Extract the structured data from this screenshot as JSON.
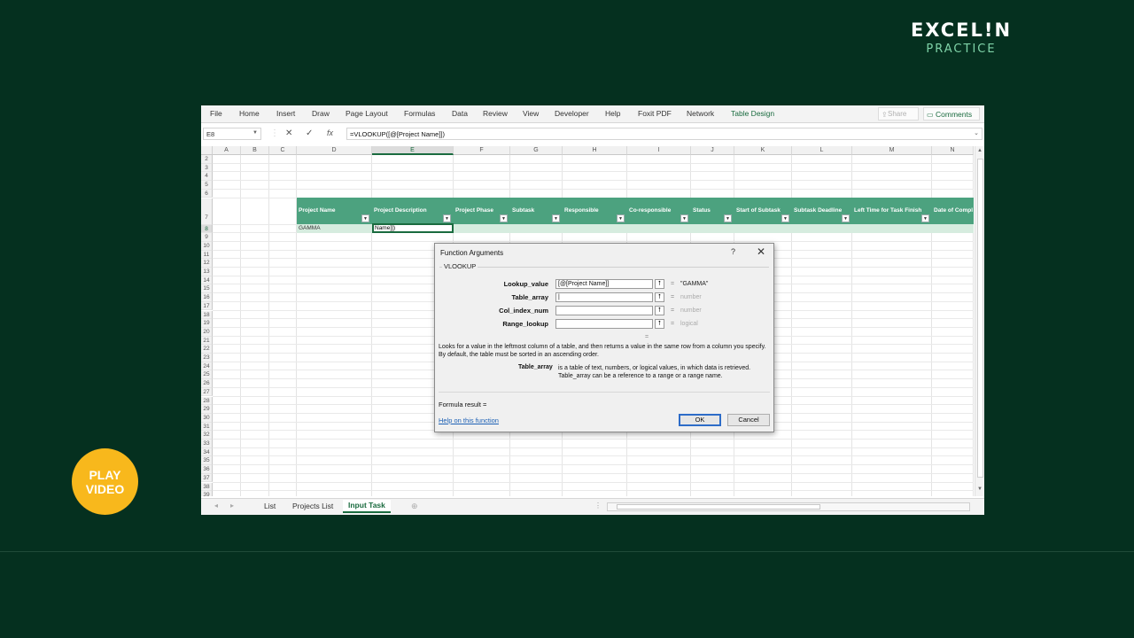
{
  "brand": {
    "main": "EXCEL!N",
    "sub": "PRACTICE"
  },
  "play": {
    "line1": "PLAY",
    "line2": "VIDEO"
  },
  "ribbon": {
    "tabs": [
      "File",
      "Home",
      "Insert",
      "Draw",
      "Page Layout",
      "Formulas",
      "Data",
      "Review",
      "View",
      "Developer",
      "Help",
      "Foxit PDF",
      "Network",
      "Table Design"
    ],
    "share": "Share",
    "comments": "Comments"
  },
  "formula_bar": {
    "name_box": "E8",
    "formula": "=VLOOKUP([@[Project Name]])"
  },
  "columns": [
    "A",
    "B",
    "C",
    "D",
    "E",
    "F",
    "G",
    "H",
    "I",
    "J",
    "K",
    "L",
    "M",
    "N"
  ],
  "rows": [
    "2",
    "3",
    "4",
    "5",
    "6",
    "7",
    "8",
    "9",
    "10",
    "11",
    "12",
    "13",
    "14",
    "15",
    "16",
    "17",
    "18",
    "19",
    "20",
    "21",
    "22",
    "23",
    "24",
    "25",
    "26",
    "27",
    "28",
    "29",
    "30",
    "31",
    "32",
    "33",
    "34",
    "35",
    "36",
    "37",
    "38",
    "39"
  ],
  "table_headers": [
    "Project Name",
    "Project Description",
    "Project Phase",
    "Subtask",
    "Responsible",
    "Co-responsible",
    "Status",
    "Start of Subtask",
    "Subtask  Deadline",
    "Left Time for Task Finish",
    "Date of Compl"
  ],
  "cells": {
    "d8": "GAMMA",
    "e8": "Name]])"
  },
  "sheet_tabs": {
    "list": "List",
    "projects": "Projects List",
    "input": "Input Task"
  },
  "dialog": {
    "title": "Function Arguments",
    "help_glyph": "?",
    "close_glyph": "✕",
    "function_name": "VLOOKUP",
    "args": [
      {
        "label": "Lookup_value",
        "value": "[@[Project Name]]",
        "result": "\"GAMMA\""
      },
      {
        "label": "Table_array",
        "value": "|",
        "result": "number"
      },
      {
        "label": "Col_index_num",
        "value": "",
        "result": "number"
      },
      {
        "label": "Range_lookup",
        "value": "",
        "result": "logical"
      }
    ],
    "equals": "=",
    "description": "Looks for a value in the leftmost column of a table, and then returns a value in the same row from a column you specify. By default, the table must be sorted in an ascending order.",
    "arg_name": "Table_array",
    "arg_description": "is a table of text, numbers, or logical values, in which data is retrieved. Table_array can be a reference to a range or a range name.",
    "formula_result": "Formula result =",
    "help_link": "Help on this function",
    "ok": "OK",
    "cancel": "Cancel"
  },
  "colors": {
    "background": "#05301f",
    "table_header": "#4ca27f",
    "accent": "#1a6b3f",
    "play": "#f8b81c"
  }
}
